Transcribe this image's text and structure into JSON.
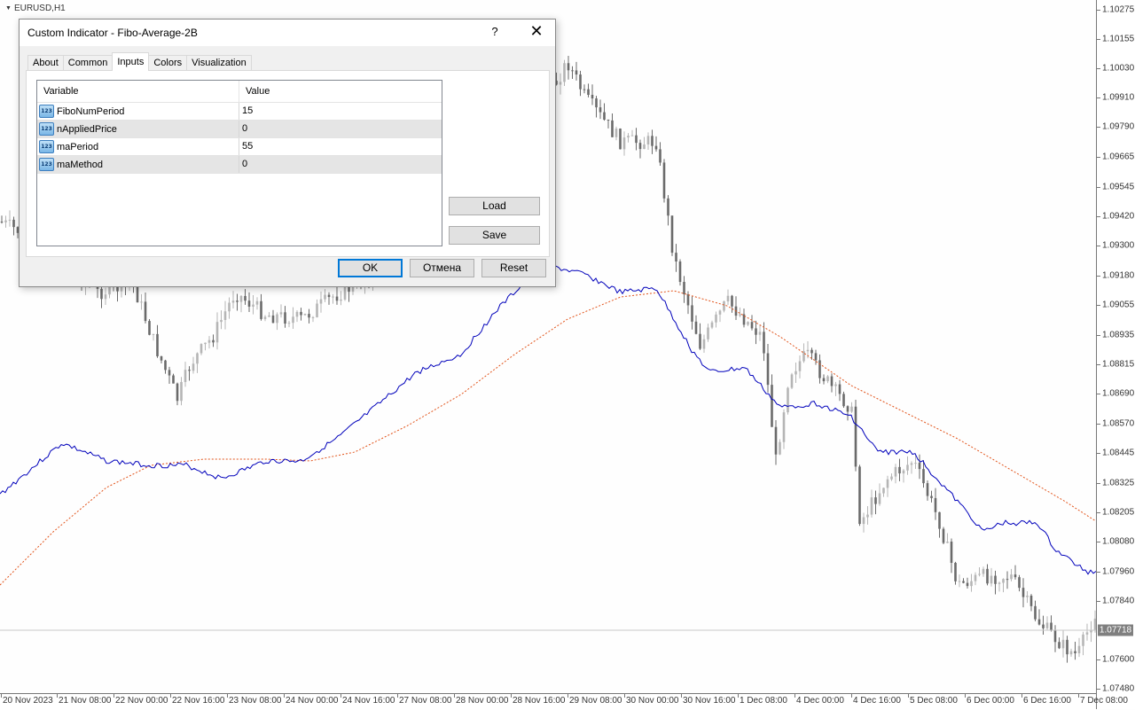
{
  "chart": {
    "symbol": "EURUSD,H1",
    "colors": {
      "fibo_line": "#0000bb",
      "ma_line": "#e2541b",
      "bull": "#b5b5b5",
      "bear": "#6a6a6a"
    },
    "price_labels": [
      "1.10275",
      "1.10155",
      "1.10030",
      "1.09910",
      "1.09790",
      "1.09665",
      "1.09545",
      "1.09420",
      "1.09300",
      "1.09180",
      "1.09055",
      "1.08935",
      "1.08815",
      "1.08690",
      "1.08570",
      "1.08445",
      "1.08325",
      "1.08205",
      "1.08080",
      "1.07960",
      "1.07840",
      "1.07600",
      "1.07480"
    ],
    "current_price": "1.07718",
    "time_labels": [
      "20 Nov 2023",
      "21 Nov 08:00",
      "22 Nov 00:00",
      "22 Nov 16:00",
      "23 Nov 08:00",
      "24 Nov 00:00",
      "24 Nov 16:00",
      "27 Nov 08:00",
      "28 Nov 00:00",
      "28 Nov 16:00",
      "29 Nov 08:00",
      "30 Nov 00:00",
      "30 Nov 16:00",
      "1 Dec 08:00",
      "4 Dec 00:00",
      "4 Dec 16:00",
      "5 Dec 08:00",
      "6 Dec 00:00",
      "6 Dec 16:00",
      "7 Dec 08:00"
    ]
  },
  "dialog": {
    "title": "Custom Indicator - Fibo-Average-2B",
    "help": "?",
    "close": "✕",
    "tabs": [
      "About",
      "Common",
      "Inputs",
      "Colors",
      "Visualization"
    ],
    "active_tab": "Inputs",
    "table": {
      "headers": {
        "variable": "Variable",
        "value": "Value"
      },
      "icon_text": "123",
      "rows": [
        {
          "name": "FiboNumPeriod",
          "value": "15"
        },
        {
          "name": "nAppliedPrice",
          "value": "0"
        },
        {
          "name": "maPeriod",
          "value": "55"
        },
        {
          "name": "maMethod",
          "value": "0"
        }
      ]
    },
    "buttons": {
      "load": "Load",
      "save": "Save",
      "ok": "OK",
      "cancel": "Отмена",
      "reset": "Reset"
    }
  }
}
